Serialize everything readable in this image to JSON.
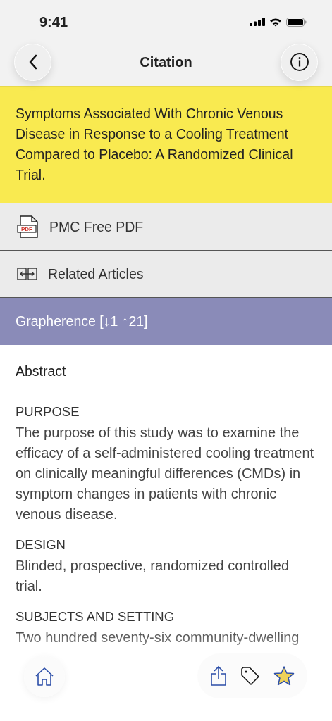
{
  "status_bar": {
    "time": "9:41"
  },
  "nav": {
    "title": "Citation"
  },
  "article_title": "Symptoms Associated With Chronic Venous Disease in Response to a Cooling Treatment Compared to Placebo: A Randomized Clinical Trial.",
  "links": [
    {
      "kind": "pdf",
      "label": "PMC Free PDF",
      "icon_text": "PDF"
    },
    {
      "kind": "related",
      "label": "Related Articles"
    },
    {
      "kind": "grapherence",
      "label": "Grapherence [↓1 ↑21]"
    }
  ],
  "abstract": {
    "heading": "Abstract",
    "sections": [
      {
        "heading": "PURPOSE",
        "text": "The purpose of this study was to examine the efficacy of a self-administered cooling treatment on clinically meaningful differences (CMDs) in symptom changes in patients with chronic venous disease."
      },
      {
        "heading": "DESIGN",
        "text": "Blinded, prospective, randomized controlled trial."
      },
      {
        "heading": "SUBJECTS AND SETTING",
        "text": "Two hundred seventy-six community-dwelling"
      }
    ]
  },
  "toolbar": {
    "starred": true
  }
}
